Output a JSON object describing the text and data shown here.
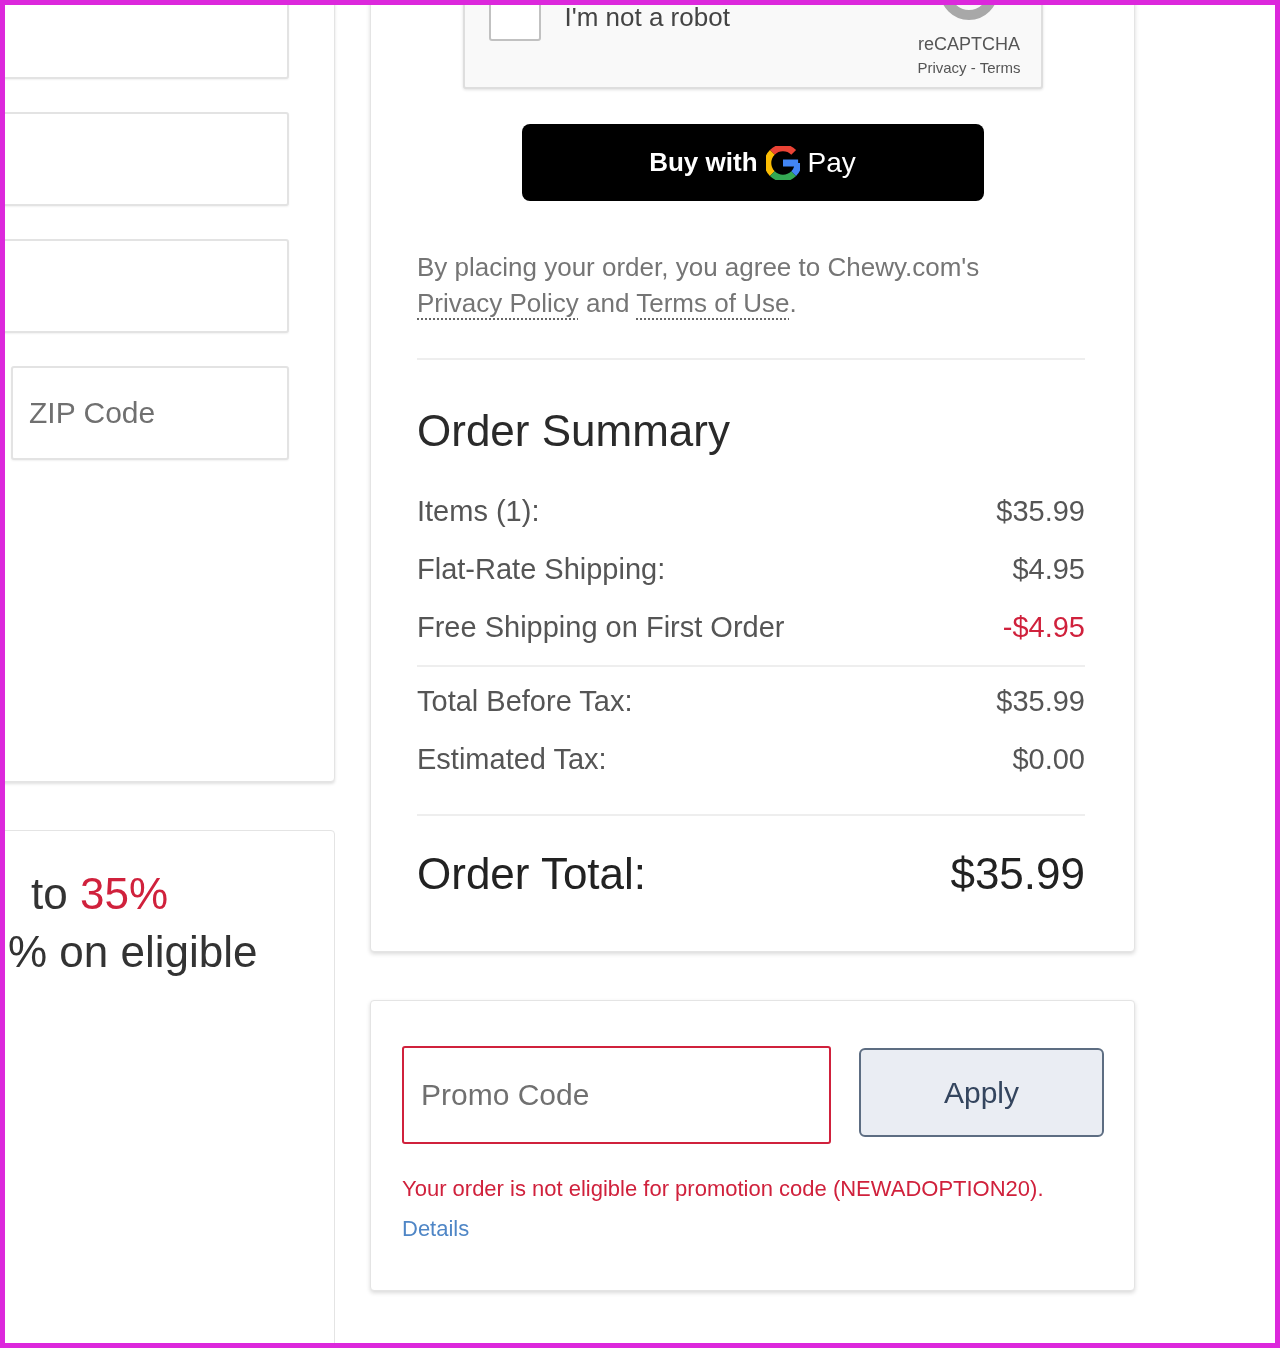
{
  "address_form": {
    "fields": [
      {
        "kind": "clipped"
      },
      {
        "kind": "clipped"
      },
      {
        "kind": "clipped"
      },
      {
        "kind": "boxed",
        "placeholder": "ZIP Code"
      }
    ]
  },
  "offer_banner": {
    "line_1": "to",
    "line_1_highlight": "35%",
    "line_2": "% on eligible"
  },
  "captcha": {
    "checked": false,
    "label": "I'm not a robot",
    "brand": "reCAPTCHA",
    "links": "Privacy - Terms"
  },
  "gpay_button": {
    "prefix": "Buy with",
    "suffix": "Pay"
  },
  "legal": {
    "parts": [
      {
        "kind": "text",
        "text": "By placing your order, you agree to Chewy.com's"
      },
      {
        "kind": "link",
        "text": "Privacy Policy"
      },
      {
        "kind": "text",
        "text": "and"
      },
      {
        "kind": "link",
        "text": "Terms of Use"
      },
      {
        "kind": "punct",
        "text": "."
      }
    ]
  },
  "order_summary": {
    "title": "Order Summary",
    "sections": [
      {
        "rows": [
          {
            "label": "Items (1):",
            "value": "$35.99",
            "kind": "charge"
          },
          {
            "label": "Flat-Rate Shipping:",
            "value": "$4.95",
            "kind": "charge"
          },
          {
            "label": "Free Shipping on First Order",
            "value": "-$4.95",
            "kind": "discount"
          }
        ]
      },
      {
        "rows": [
          {
            "label": "Total Before Tax:",
            "value": "$35.99",
            "kind": "charge"
          },
          {
            "label": "Estimated Tax:",
            "value": "$0.00",
            "kind": "charge"
          }
        ]
      }
    ],
    "total": {
      "label": "Order Total:",
      "value": "$35.99"
    }
  },
  "promo": {
    "placeholder": "Promo Code",
    "invalid": true,
    "button": "Apply",
    "error": "Your order is not eligible for promotion code (NEWADOPTION20).",
    "details_link": "Details"
  }
}
